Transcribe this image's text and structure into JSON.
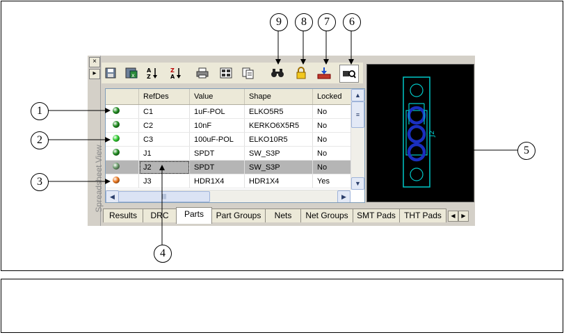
{
  "panel": {
    "side_label": "Spreadsheet View",
    "close_glyph": "×",
    "pin_glyph": "▸"
  },
  "toolbar": {
    "buttons": [
      {
        "name": "save-icon"
      },
      {
        "name": "export-excel-icon"
      },
      {
        "name": "sort-ascending-icon",
        "text": "A↓Z"
      },
      {
        "name": "sort-descending-icon",
        "text": "Z↓A"
      },
      {
        "name": "print-icon",
        "text": "🖶"
      },
      {
        "name": "grid-view-icon"
      },
      {
        "name": "copy-icon"
      },
      {
        "name": "find-binoculars-icon",
        "text": "👓"
      },
      {
        "name": "lock-icon"
      },
      {
        "name": "import-icon"
      },
      {
        "name": "zoom-preview-icon"
      }
    ]
  },
  "table": {
    "columns": [
      "",
      "RefDes",
      "Value",
      "Shape",
      "Locked"
    ],
    "rows": [
      {
        "status_color": "#1d8a1d",
        "refdes": "C1",
        "value": "1uF-POL",
        "shape": "ELKO5R5",
        "locked": "No"
      },
      {
        "status_color": "#1d8a1d",
        "refdes": "C2",
        "value": "10nF",
        "shape": "KERKO6X5R5",
        "locked": "No"
      },
      {
        "status_color": "#2ecc2e",
        "refdes": "C3",
        "value": "100uF-POL",
        "shape": "ELKO10R5",
        "locked": "No"
      },
      {
        "status_color": "#1d8a1d",
        "refdes": "J1",
        "value": "SPDT",
        "shape": "SW_S3P",
        "locked": "No"
      },
      {
        "status_color": "#6a9a6a",
        "refdes": "J2",
        "value": "SPDT",
        "shape": "SW_S3P",
        "locked": "No",
        "selected": true
      },
      {
        "status_color": "#e8731a",
        "refdes": "J3",
        "value": "HDR1X4",
        "shape": "HDR1X4",
        "locked": "Yes"
      }
    ],
    "hscroll_grip": "|||",
    "vscroll_grip": "≡"
  },
  "preview": {
    "part_label": "J2",
    "outline_color": "#00c8c8",
    "pad_color": "#1a2fbf"
  },
  "tabs": [
    {
      "label": "Results"
    },
    {
      "label": "DRC"
    },
    {
      "label": "Parts",
      "active": true
    },
    {
      "label": "Part Groups"
    },
    {
      "label": "Nets"
    },
    {
      "label": "Net Groups"
    },
    {
      "label": "SMT Pads"
    },
    {
      "label": "THT Pads"
    }
  ],
  "callouts": [
    "1",
    "2",
    "3",
    "4",
    "5",
    "6",
    "7",
    "8",
    "9"
  ]
}
